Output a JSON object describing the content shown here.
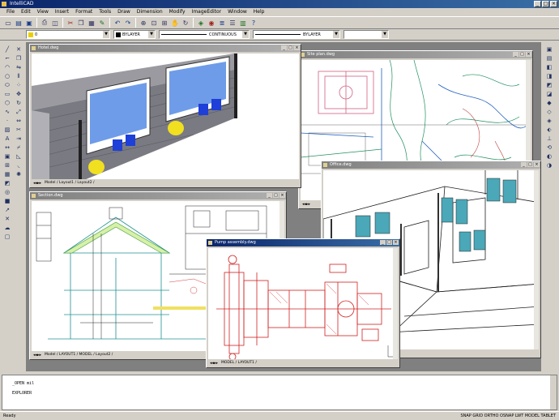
{
  "app": {
    "title": "IntelliCAD",
    "window_buttons": [
      "_",
      "□",
      "×"
    ]
  },
  "menu": [
    "File",
    "Edit",
    "View",
    "Insert",
    "Format",
    "Tools",
    "Draw",
    "Dimension",
    "Modify",
    "ImageEditor",
    "Window",
    "Help"
  ],
  "properties_bar": {
    "layer": "0",
    "color": "BYLAYER",
    "linetype": "CONTINUOUS",
    "lineweight": "BYLAYER",
    "colors": {
      "layer_swatch": "#e8d000",
      "color_swatch": "#000000"
    }
  },
  "windows": [
    {
      "title": "Hotel.dwg",
      "tabs": "Model / Layout1 / Layout2 /"
    },
    {
      "title": "Site plan.dwg",
      "tabs": ""
    },
    {
      "title": "Office.dwg",
      "tabs": ""
    },
    {
      "title": "Section.dwg",
      "tabs": "Model / LAYOUT1 / MODEL / Layout2 /"
    },
    {
      "title": "Pump assembly.dwg",
      "tabs": "MODEL / LAYOUT1 /"
    }
  ],
  "command_line": {
    "lines": [
      "_OPEN mil",
      "EXPLORER"
    ]
  },
  "status": {
    "left": "Ready",
    "right": "SNAP GRID ORTHO OSNAP LWT MODEL TABLET"
  }
}
